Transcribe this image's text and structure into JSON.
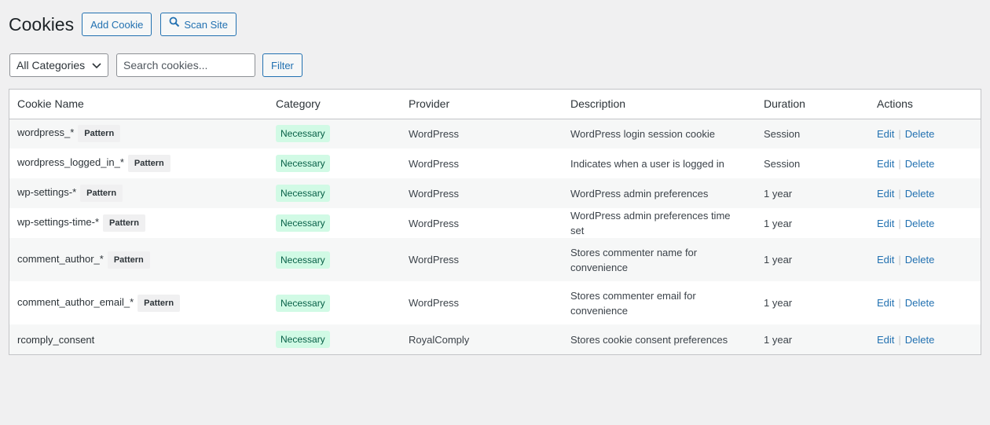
{
  "header": {
    "title": "Cookies",
    "add_label": "Add Cookie",
    "scan_label": "Scan Site"
  },
  "filters": {
    "category_selected": "All Categories",
    "search_placeholder": "Search cookies...",
    "filter_label": "Filter"
  },
  "table": {
    "columns": [
      "Cookie Name",
      "Category",
      "Provider",
      "Description",
      "Duration",
      "Actions"
    ],
    "pattern_label": "Pattern",
    "edit_label": "Edit",
    "delete_label": "Delete",
    "rows": [
      {
        "name": "wordpress_*",
        "pattern": true,
        "category": "Necessary",
        "provider": "WordPress",
        "description": "WordPress login session cookie",
        "duration": "Session"
      },
      {
        "name": "wordpress_logged_in_*",
        "pattern": true,
        "category": "Necessary",
        "provider": "WordPress",
        "description": "Indicates when a user is logged in",
        "duration": "Session"
      },
      {
        "name": "wp-settings-*",
        "pattern": true,
        "category": "Necessary",
        "provider": "WordPress",
        "description": "WordPress admin preferences",
        "duration": "1 year"
      },
      {
        "name": "wp-settings-time-*",
        "pattern": true,
        "category": "Necessary",
        "provider": "WordPress",
        "description": "WordPress admin preferences time set",
        "duration": "1 year"
      },
      {
        "name": "comment_author_*",
        "pattern": true,
        "category": "Necessary",
        "provider": "WordPress",
        "description": "Stores commenter name for convenience",
        "duration": "1 year"
      },
      {
        "name": "comment_author_email_*",
        "pattern": true,
        "category": "Necessary",
        "provider": "WordPress",
        "description": "Stores commenter email for convenience",
        "duration": "1 year"
      },
      {
        "name": "rcomply_consent",
        "pattern": false,
        "category": "Necessary",
        "provider": "RoyalComply",
        "description": "Stores cookie consent preferences",
        "duration": "1 year"
      }
    ]
  },
  "colors": {
    "accent": "#2271b1",
    "badge_bg": "#d1fae5",
    "badge_text": "#065f46"
  }
}
